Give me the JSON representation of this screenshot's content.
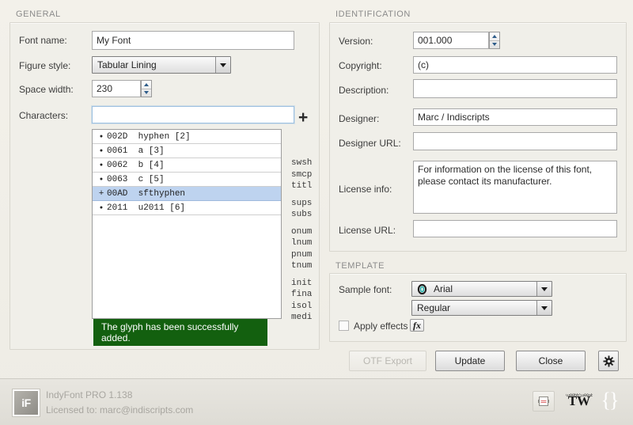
{
  "sections": {
    "general": "GENERAL",
    "identification": "IDENTIFICATION",
    "template": "TEMPLATE"
  },
  "general": {
    "font_name_label": "Font name:",
    "font_name_value": "My Font",
    "figure_style_label": "Figure style:",
    "figure_style_value": "Tabular Lining",
    "space_width_label": "Space width:",
    "space_width_value": "230",
    "characters_label": "Characters:",
    "characters_value": "",
    "characters_placeholder": "",
    "add_glyph_label": "+",
    "glyph_rows": [
      {
        "mark": "●",
        "code": "002D",
        "name": "hyphen",
        "index": "[2]"
      },
      {
        "mark": "●",
        "code": "0061",
        "name": "a",
        "index": "[3]"
      },
      {
        "mark": "●",
        "code": "0062",
        "name": "b",
        "index": "[4]"
      },
      {
        "mark": "●",
        "code": "0063",
        "name": "c",
        "index": "[5]"
      },
      {
        "mark": "+",
        "code": "00AD",
        "name": "sfthyphen",
        "index": "",
        "selected": true
      },
      {
        "mark": "●",
        "code": "2011",
        "name": "u2011",
        "index": "[6]"
      }
    ],
    "feature_tags": [
      [
        "swsh",
        "smcp",
        "titl"
      ],
      [
        "sups",
        "subs"
      ],
      [
        "onum",
        "lnum",
        "pnum",
        "tnum"
      ],
      [
        "init",
        "fina",
        "isol",
        "medi"
      ]
    ],
    "status_message": "The glyph has been successfully added.",
    "status_color": "#13600f"
  },
  "identification": {
    "version_label": "Version:",
    "version_value": "001.000",
    "copyright_label": "Copyright:",
    "copyright_value": "(c)",
    "description_label": "Description:",
    "description_value": "",
    "designer_label": "Designer:",
    "designer_value": "Marc / Indiscripts",
    "designer_url_label": "Designer URL:",
    "designer_url_value": "",
    "license_info_label": "License info:",
    "license_info_value": "For information on the license of this font, please contact its manufacturer.",
    "license_url_label": "License URL:",
    "license_url_value": ""
  },
  "template": {
    "sample_font_label": "Sample font:",
    "sample_font_value": "Arial",
    "sample_style_value": "Regular",
    "apply_effects_label": "Apply effects",
    "apply_effects_checked": false,
    "fx_label": "fx"
  },
  "actions": {
    "otf_export": "OTF Export",
    "otf_export_enabled": false,
    "update": "Update",
    "close": "Close",
    "settings_icon": "gear-icon"
  },
  "footer": {
    "logo_text": "iF",
    "product": "IndyFont PRO  1.138",
    "license": "Licensed to: marc@indiscripts.com",
    "icons": [
      "script-panel-icon",
      "indiscripts-tw-logo",
      "braces-icon"
    ],
    "braces_glyph": "{}"
  }
}
